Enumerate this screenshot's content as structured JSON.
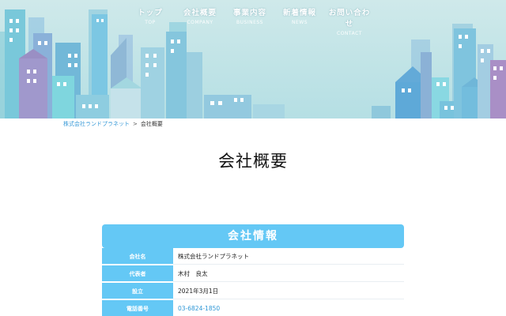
{
  "nav": {
    "items": [
      {
        "jp": "トップ",
        "en": "TOP"
      },
      {
        "jp": "会社概要",
        "en": "COMPANY"
      },
      {
        "jp": "事業内容",
        "en": "BUSINESS"
      },
      {
        "jp": "新着情報",
        "en": "NEWS"
      },
      {
        "jp": "お問い合わせ",
        "en": "CONTACT"
      }
    ]
  },
  "breadcrumb": {
    "home": "株式会社ランドプラネット",
    "separator": ">",
    "current": "会社概要"
  },
  "page": {
    "title": "会社概要"
  },
  "company_info": {
    "header": "会社情報",
    "rows": [
      {
        "label": "会社名",
        "value": "株式会社ランドプラネット"
      },
      {
        "label": "代表者",
        "value": "木村　良太"
      },
      {
        "label": "設立",
        "value": "2021年3月1日"
      },
      {
        "label": "電話番号",
        "value": "03-6824-1850"
      }
    ]
  },
  "colors": {
    "accent": "#64c8f5",
    "link": "#3a9bd8",
    "hero_sky": "#c4e6e8"
  }
}
